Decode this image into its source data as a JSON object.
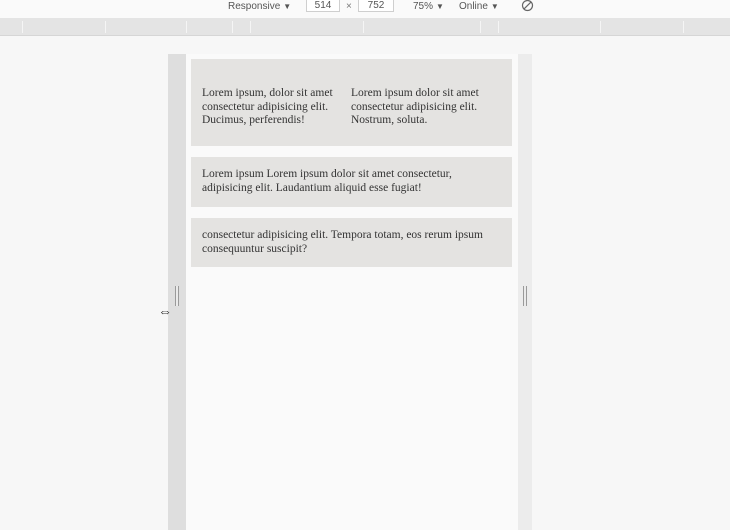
{
  "toolbar": {
    "device": "Responsive",
    "width": "514",
    "times": "×",
    "height": "752",
    "zoom": "75%",
    "network": "Online",
    "caret": "▼",
    "rotate_icon": "rotate-icon"
  },
  "content": {
    "card1": {
      "col1": "Lorem ipsum, dolor sit amet consectetur adipisicing elit. Ducimus, perferendis!",
      "col2": "Lorem ipsum dolor sit amet consectetur adipisicing elit. Nostrum, soluta."
    },
    "card2": "Lorem ipsum Lorem ipsum dolor sit amet consectetur, adipisicing elit. Laudantium aliquid esse fugiat!",
    "card3": "consectetur adipisicing elit. Tempora totam, eos rerum ipsum consequuntur suscipit?"
  },
  "cursor": "⇔"
}
